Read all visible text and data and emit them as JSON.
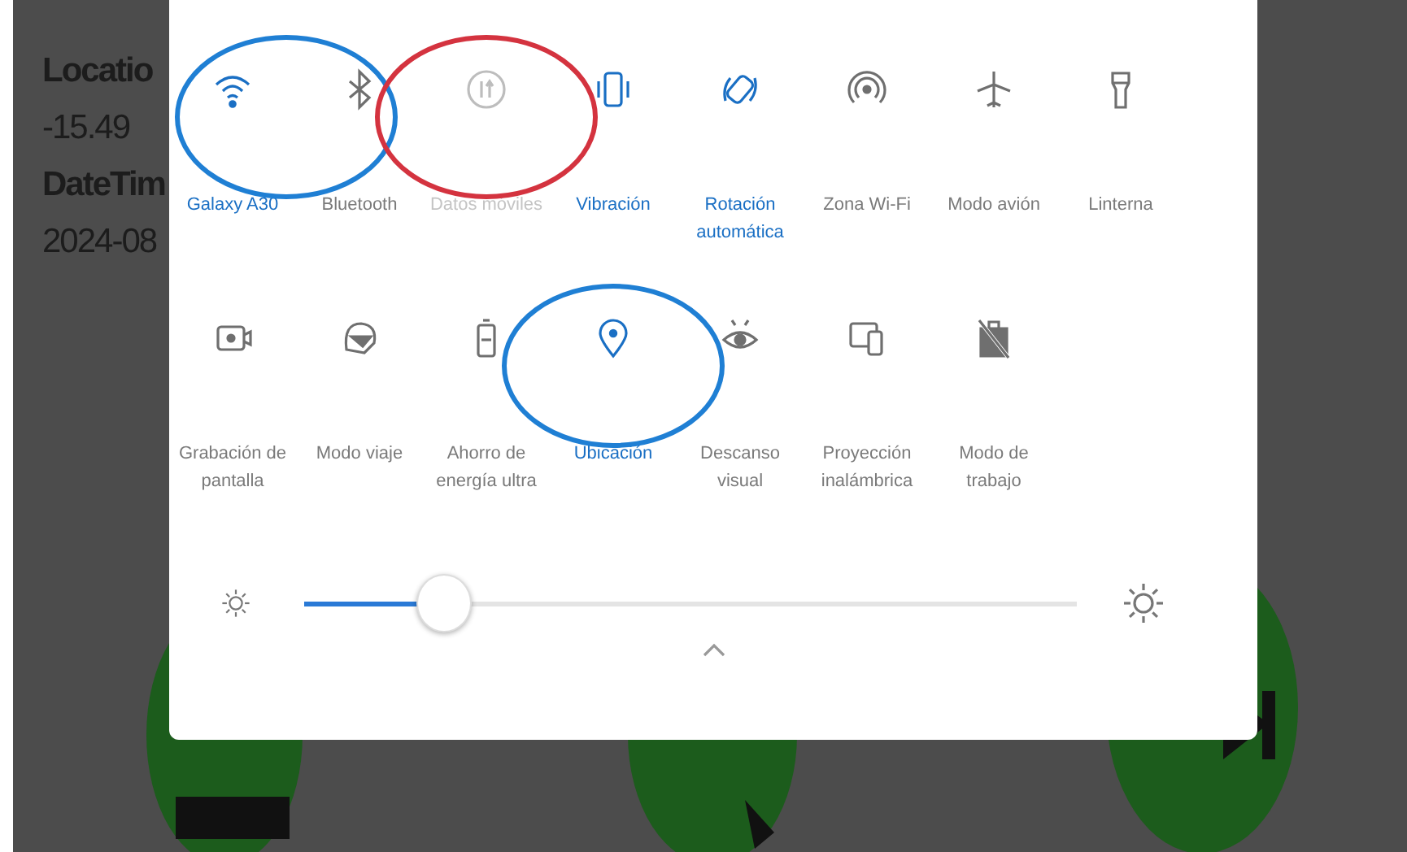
{
  "background": {
    "lines": [
      {
        "text": "Locatio",
        "bold": true
      },
      {
        "text": "-15.49",
        "bold": false
      },
      {
        "text": "DateTim",
        "bold": true
      },
      {
        "text": "2024-08",
        "bold": false
      }
    ]
  },
  "quick_settings": {
    "tiles": [
      {
        "label": "Galaxy A30",
        "on": true,
        "disabled": false,
        "annotation": {
          "color": "#1f7fd4"
        }
      },
      {
        "label": "Bluetooth",
        "on": false,
        "disabled": false
      },
      {
        "label": "Datos móviles",
        "on": false,
        "disabled": true,
        "annotation": {
          "color": "#d4333f"
        }
      },
      {
        "label": "Vibración",
        "on": true,
        "disabled": false
      },
      {
        "label": "Rotación automática",
        "on": true,
        "disabled": false
      },
      {
        "label": "Zona Wi-Fi",
        "on": false,
        "disabled": false
      },
      {
        "label": "Modo avión",
        "on": false,
        "disabled": false
      },
      {
        "label": "Linterna",
        "on": false,
        "disabled": false
      },
      {
        "label": "Grabación de pantalla",
        "on": false,
        "disabled": false
      },
      {
        "label": "Modo viaje",
        "on": false,
        "disabled": false
      },
      {
        "label": "Ahorro de energía ultra",
        "on": false,
        "disabled": false
      },
      {
        "label": "Ubicación",
        "on": true,
        "disabled": false,
        "annotation": {
          "color": "#1f7fd4"
        }
      },
      {
        "label": "Descanso visual",
        "on": false,
        "disabled": false
      },
      {
        "label": "Proyección inalámbrica",
        "on": false,
        "disabled": false
      },
      {
        "label": "Modo de trabajo",
        "on": false,
        "disabled": false
      }
    ],
    "brightness": {
      "level": 0.18
    }
  }
}
